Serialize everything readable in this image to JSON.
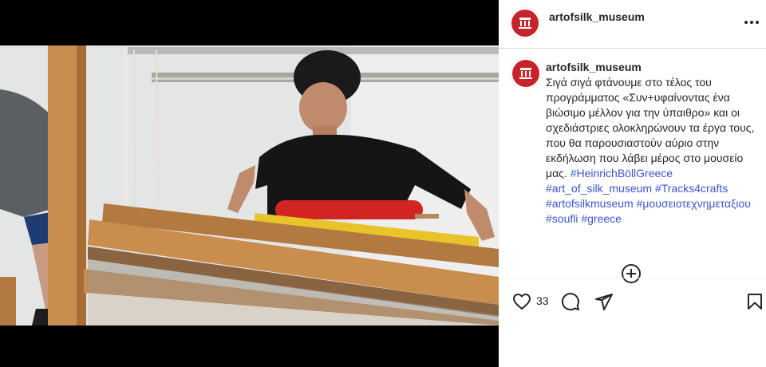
{
  "post": {
    "username": "artofsilk_museum",
    "caption_username": "artofsilk_museum",
    "caption_lines": [
      "Σιγά σιγά φτάνουμε στο τέλος του",
      "προγράμματος «Συν+υφαίνοντας ένα",
      "βιώσιμο μέλλον για την ύπαιθρο» και",
      "οι σχεδιάστριες ολοκληρώνουν τα",
      "έργα τους, που θα παρουσιαστούν",
      "αύριο στην εκδήλωση που λάβει μέρος",
      "στο μουσείο μας."
    ],
    "hashtags": [
      "#HeinrichBöllGreece",
      "#art_of_silk_museum",
      "#Tracks4crafts",
      "#artofsilkmuseum",
      "#μουσειοτεχνημεταξιου",
      "#soufli",
      "#greece"
    ],
    "like_count": "33"
  },
  "icons": {
    "more": "more-horizontal-icon",
    "like": "heart-icon",
    "comment": "comment-icon",
    "share": "send-icon",
    "save": "bookmark-icon",
    "load_more": "plus-circle-icon",
    "mute": "volume-muted-icon"
  },
  "colors": {
    "avatar": "#c7232b",
    "hashtag": "#3a56d0",
    "text": "#262626",
    "media_bg": "#000000"
  }
}
